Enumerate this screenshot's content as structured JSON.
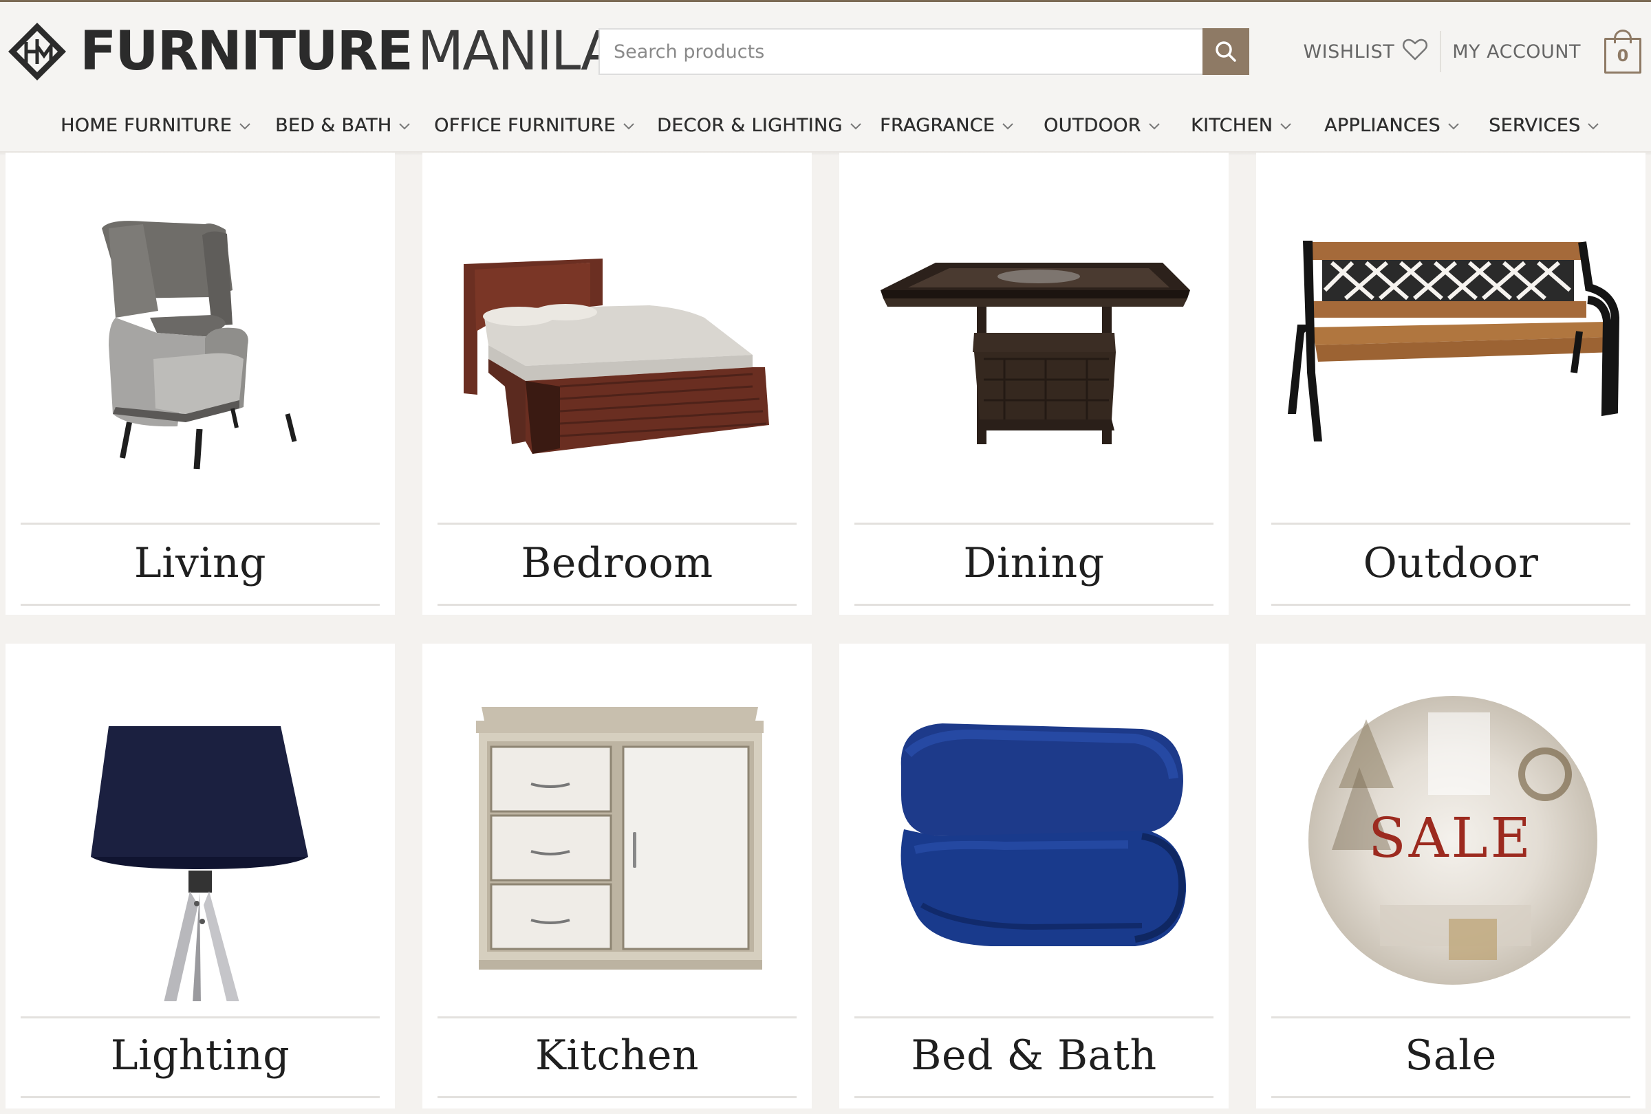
{
  "brand": {
    "bold": "FURNITURE",
    "light": "MANILA",
    "accent": "#8e7a65"
  },
  "search": {
    "placeholder": "Search products",
    "icon": "search-icon"
  },
  "top_links": {
    "wishlist": "WISHLIST",
    "account": "MY ACCOUNT",
    "cart_count": "0"
  },
  "nav": [
    {
      "label": "HOME FURNITURE"
    },
    {
      "label": "BED & BATH"
    },
    {
      "label": "OFFICE FURNITURE"
    },
    {
      "label": "DECOR & LIGHTING"
    },
    {
      "label": "FRAGRANCE"
    },
    {
      "label": "OUTDOOR"
    },
    {
      "label": "KITCHEN"
    },
    {
      "label": "APPLIANCES"
    },
    {
      "label": "SERVICES"
    }
  ],
  "categories": [
    {
      "label": "Living",
      "icon": "armchair-icon"
    },
    {
      "label": "Bedroom",
      "icon": "bed-icon"
    },
    {
      "label": "Dining",
      "icon": "dining-table-icon"
    },
    {
      "label": "Outdoor",
      "icon": "bench-icon"
    },
    {
      "label": "Lighting",
      "icon": "floor-lamp-icon"
    },
    {
      "label": "Kitchen",
      "icon": "cabinet-icon"
    },
    {
      "label": "Bed & Bath",
      "icon": "blanket-icon"
    },
    {
      "label": "Sale",
      "icon": "sale-badge-icon",
      "badge_text": "SALE"
    }
  ]
}
